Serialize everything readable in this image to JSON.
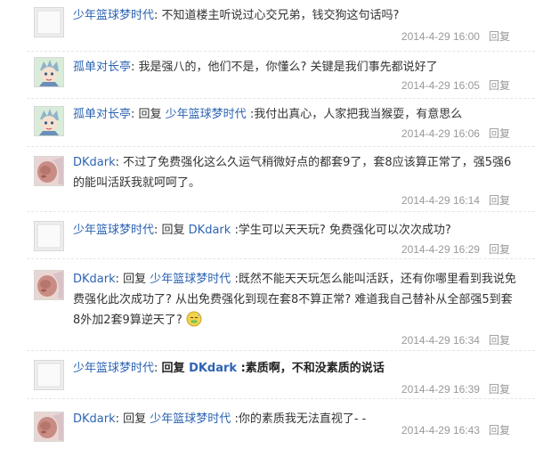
{
  "replies": [
    {
      "author": "少年篮球梦时代",
      "avatar": "default-avatar-icon",
      "content": "不知道楼主听说过心交兄弟，钱交狗这句话吗?",
      "time": "2014-4-29 16:00",
      "reply_label": "回复"
    },
    {
      "author": "孤单对长亭",
      "avatar": "anime-character-avatar",
      "content": "我是强八的，他们不是，你懂么? 关键是我们事先都说好了",
      "time": "2014-4-29 16:05",
      "reply_label": "回复"
    },
    {
      "author": "孤单对长亭",
      "avatar": "anime-character-avatar",
      "prefix": "回复 ",
      "mention": "少年篮球梦时代",
      "content": " :我付出真心，人家把我当猴耍，有意思么",
      "time": "2014-4-29 16:06",
      "reply_label": "回复"
    },
    {
      "author": "DKdark",
      "avatar": "baby-photo-avatar",
      "content": "不过了免费强化这么久运气稍微好点的都套9了，套8应该算正常了，强5强6的能叫活跃我就呵呵了。",
      "time": "2014-4-29 16:14",
      "reply_label": "回复"
    },
    {
      "author": "少年篮球梦时代",
      "avatar": "default-avatar-icon",
      "prefix": "回复 ",
      "mention": "DKdark",
      "content": " :学生可以天天玩? 免费强化可以次次成功?",
      "time": "2014-4-29 16:29",
      "reply_label": "回复"
    },
    {
      "author": "DKdark",
      "avatar": "baby-photo-avatar",
      "prefix": "回复 ",
      "mention": "少年篮球梦时代",
      "content": " :既然不能天天玩怎么能叫活跃，还有你哪里看到我说免费强化此次成功了? 从出免费强化到现在套8不算正常? 难道我自己替补从全部强5到套8外加2套9算逆天了?",
      "emoji": "sweat-emoji-icon",
      "time": "2014-4-29 16:34",
      "reply_label": "回复"
    },
    {
      "author": "少年篮球梦时代",
      "avatar": "default-avatar-icon",
      "prefix": "回复 ",
      "mention": "DKdark",
      "content": " :素质啊，不和没素质的说话",
      "bold": true,
      "time": "2014-4-29 16:39",
      "reply_label": "回复"
    },
    {
      "author": "DKdark",
      "avatar": "baby-photo-avatar",
      "prefix": "回复 ",
      "mention": "少年篮球梦时代",
      "content": " :你的素质我无法直视了- -",
      "time": "2014-4-29 16:43",
      "reply_label": "回复"
    }
  ]
}
